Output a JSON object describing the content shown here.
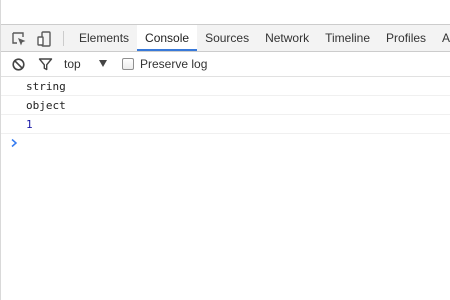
{
  "toolbar": {
    "icons": [
      "inspect-element-icon",
      "device-mode-icon"
    ],
    "tabs": [
      {
        "label": "Elements",
        "active": false
      },
      {
        "label": "Console",
        "active": true
      },
      {
        "label": "Sources",
        "active": false
      },
      {
        "label": "Network",
        "active": false
      },
      {
        "label": "Timeline",
        "active": false
      },
      {
        "label": "Profiles",
        "active": false
      },
      {
        "label": "Ap",
        "active": false
      }
    ]
  },
  "filterbar": {
    "icons": [
      "clear-console-icon",
      "filter-icon"
    ],
    "context": "top",
    "preserve_log_label": "Preserve log",
    "preserve_log_checked": false
  },
  "console": {
    "messages": [
      {
        "text": "string",
        "kind": "string"
      },
      {
        "text": "object",
        "kind": "string"
      },
      {
        "text": "1",
        "kind": "number"
      }
    ],
    "prompt_icon": "prompt-chevron-icon"
  },
  "colors": {
    "accent": "#3879d9",
    "number": "#1a1aa6",
    "prompt": "#367cf1"
  }
}
